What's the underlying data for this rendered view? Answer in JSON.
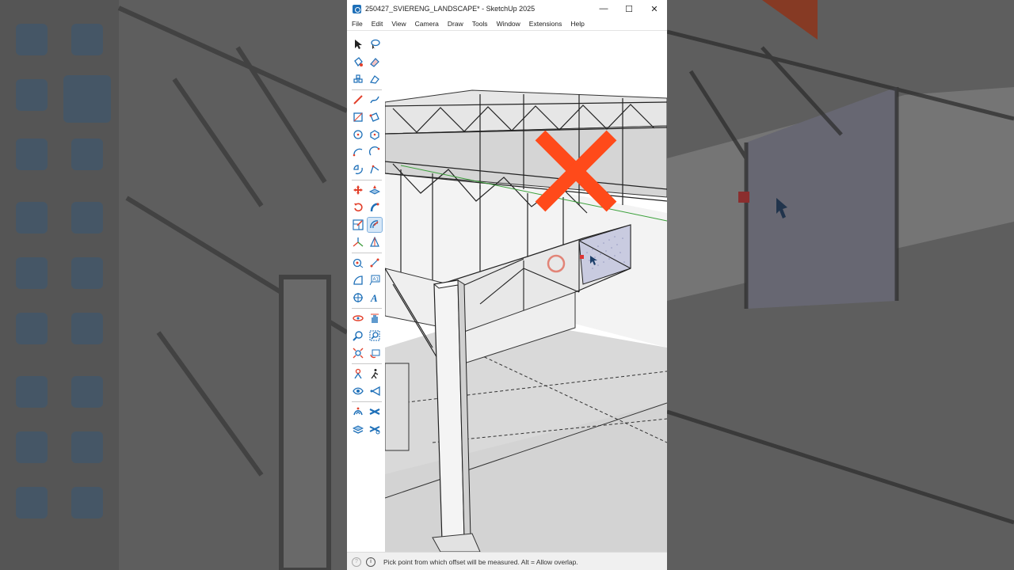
{
  "window": {
    "title": "250427_SVIERENG_LANDSCAPE* - SketchUp 2025",
    "minimize": "—",
    "maximize": "☐",
    "close": "✕"
  },
  "menu": [
    "File",
    "Edit",
    "View",
    "Camera",
    "Draw",
    "Tools",
    "Window",
    "Extensions",
    "Help"
  ],
  "tools": [
    "select",
    "lasso-select",
    "paint-bucket",
    "eraser",
    "components",
    "tag-eraser",
    "pencil",
    "freehand",
    "rectangle",
    "rotated-rectangle",
    "circle",
    "polygon",
    "arc",
    "two-point-arc",
    "pie",
    "three-point-arc",
    "move",
    "push-pull",
    "rotate",
    "follow-me",
    "scale",
    "offset",
    "axes",
    "section-plane",
    "tape-measure",
    "dimension",
    "protractor",
    "text",
    "3d-text-reference",
    "3d-text",
    "orbit",
    "pan",
    "zoom",
    "zoom-window",
    "zoom-extents",
    "previous-view",
    "position-camera",
    "walk",
    "look-around",
    "advanced-camera",
    "sandbox-from-contours",
    "sandbox-smoove",
    "sandbox-stamp",
    "sandbox-drape"
  ],
  "active_tool": "offset",
  "status": {
    "message": "Pick point from which offset will be measured. Alt = Allow overlap.",
    "icon1": "?",
    "icon2": "i"
  },
  "annotation": {
    "mark": "cross",
    "color": "#ff4a1a"
  },
  "colors": {
    "accent": "#1d6fb8",
    "tool_red": "#e2402b",
    "annotation": "#ff4a1a"
  }
}
